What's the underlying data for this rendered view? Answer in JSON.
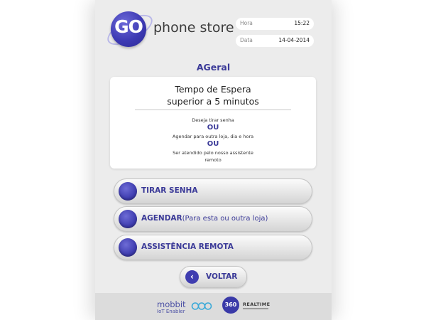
{
  "header": {
    "logo_badge_text": "GO",
    "logo_text": "phone store",
    "hora": {
      "label": "Hora",
      "value": "15:22"
    },
    "data": {
      "label": "Data",
      "value": "14-04-2014"
    }
  },
  "store_name": "AGeral",
  "card": {
    "title_line1": "Tempo de Espera",
    "title_line2": "superior a 5 minutos",
    "line1": "Deseja tirar senha",
    "or1": "OU",
    "line2": "Agendar para outra loja, dia e hora",
    "or2": "OU",
    "line3": "Ser atendido pelo nosso assistente",
    "line4": "remoto"
  },
  "options": [
    {
      "label": "TIRAR SENHA",
      "sub": ""
    },
    {
      "label": "AGENDAR",
      "sub": "(Para esta ou outra loja)"
    },
    {
      "label": "ASSISTÊNCIA REMOTA",
      "sub": ""
    }
  ],
  "back_label": "VOLTAR",
  "footer": {
    "mobbit": "mobbit",
    "mobbit_sub": "IoT Enabler",
    "badge": "360",
    "realtime": "REALTIME"
  },
  "colors": {
    "accent": "#3b3a98",
    "panel": "#ececec"
  }
}
